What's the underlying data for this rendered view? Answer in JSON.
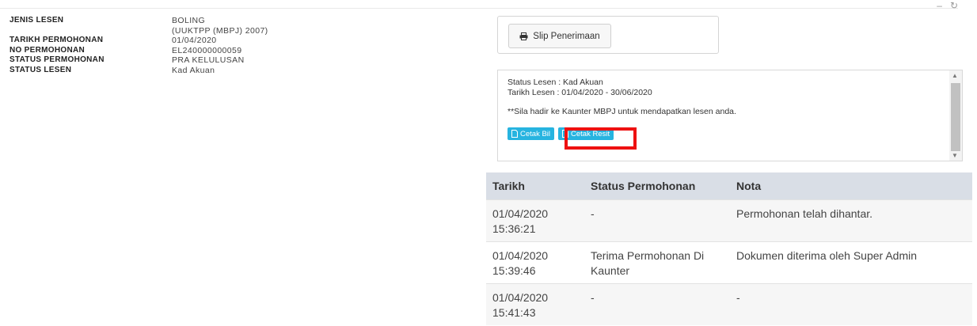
{
  "window": {
    "minimize": "–",
    "refresh": "↻"
  },
  "info": {
    "rows": [
      {
        "label": "JENIS LESEN",
        "value": "BOLING"
      },
      {
        "label": "",
        "value": "(UUKTPP (MBPJ) 2007)"
      },
      {
        "label": "TARIKH PERMOHONAN",
        "value": "01/04/2020"
      },
      {
        "label": "NO PERMOHONAN",
        "value": "EL240000000059"
      },
      {
        "label": "STATUS PERMOHONAN",
        "value": "PRA KELULUSAN"
      },
      {
        "label": "STATUS LESEN",
        "value": "Kad Akuan"
      }
    ]
  },
  "slip": {
    "label": "Slip Penerimaan",
    "icon": "print-icon"
  },
  "status_panel": {
    "line1": "Status Lesen : Kad Akuan",
    "line2": "Tarikh Lesen : 01/04/2020 - 30/06/2020",
    "note": "**Sila hadir ke Kaunter MBPJ untuk mendapatkan lesen anda.",
    "cetak_bil": "Cetak Bil",
    "cetak_resit": "Cetak Resit"
  },
  "history": {
    "headers": [
      "Tarikh",
      "Status Permohonan",
      "Nota"
    ],
    "rows": [
      {
        "date": "01/04/2020",
        "time": "15:36:21",
        "status1": "-",
        "status2": "",
        "nota": "Permohonan telah dihantar."
      },
      {
        "date": "01/04/2020",
        "time": "15:39:46",
        "status1": "Terima Permohonan Di",
        "status2": "Kaunter",
        "nota": "Dokumen diterima oleh Super Admin"
      },
      {
        "date": "01/04/2020",
        "time": "15:41:43",
        "status1": "-",
        "status2": "",
        "nota": "-"
      }
    ]
  },
  "colors": {
    "accent_button": "#27b4e0",
    "highlight": "#ee1111",
    "table_header": "#d9dee6"
  }
}
